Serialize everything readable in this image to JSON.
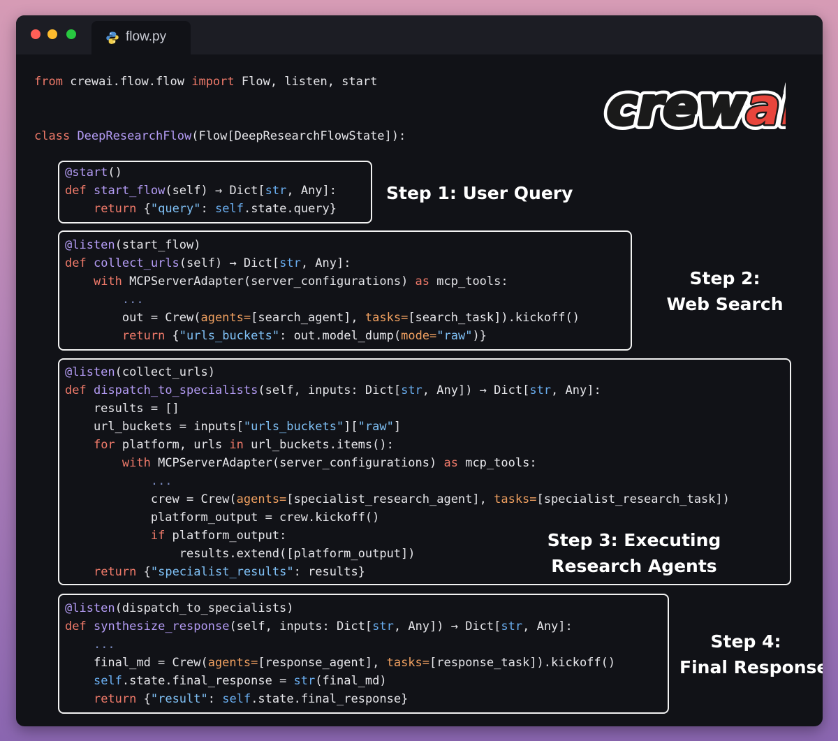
{
  "window": {
    "tab_title": "flow.py",
    "tab_icon": "python-icon",
    "traffic_lights": [
      "close",
      "minimize",
      "maximize"
    ]
  },
  "logo": {
    "text": "crewai"
  },
  "code": {
    "import_line": {
      "kw1": "from",
      "module": "crewai.flow.flow",
      "kw2": "import",
      "names": "Flow, listen, start"
    },
    "class_line": {
      "kw": "class",
      "name": "DeepResearchFlow",
      "base": "(Flow[DeepResearchFlowState]):"
    },
    "step1": {
      "decorator": "@start",
      "dec_args": "()",
      "fn": "start_flow",
      "sig_a": "(self) → Dict[",
      "return_body": "{\"query\": self.state.query}"
    },
    "step2": {
      "decorator": "@listen",
      "dec_args": "(start_flow)",
      "fn": "collect_urls",
      "sig": "(self) → Dict[str, Any]:"
    },
    "step3": {
      "decorator": "@listen",
      "dec_args": "(collect_urls)",
      "fn": "dispatch_to_specialists"
    },
    "step4": {
      "decorator": "@listen",
      "dec_args": "(dispatch_to_specialists)",
      "fn": "synthesize_response"
    }
  },
  "labels": {
    "step1": "Step 1: User Query",
    "step2_line1": "Step 2:",
    "step2_line2": "Web Search",
    "step3_line1": "Step 3: Executing",
    "step3_line2": "Research Agents",
    "step4_line1": "Step 4:",
    "step4_line2": "Final Response"
  },
  "colors": {
    "background_top": "#d69bb5",
    "background_bottom": "#8a66b0",
    "editor_bg": "#111217",
    "keyword": "#f07a6a",
    "function": "#b49cf5",
    "string": "#7fc0f5",
    "kwarg": "#f0a060",
    "logo_accent": "#e8453c"
  }
}
